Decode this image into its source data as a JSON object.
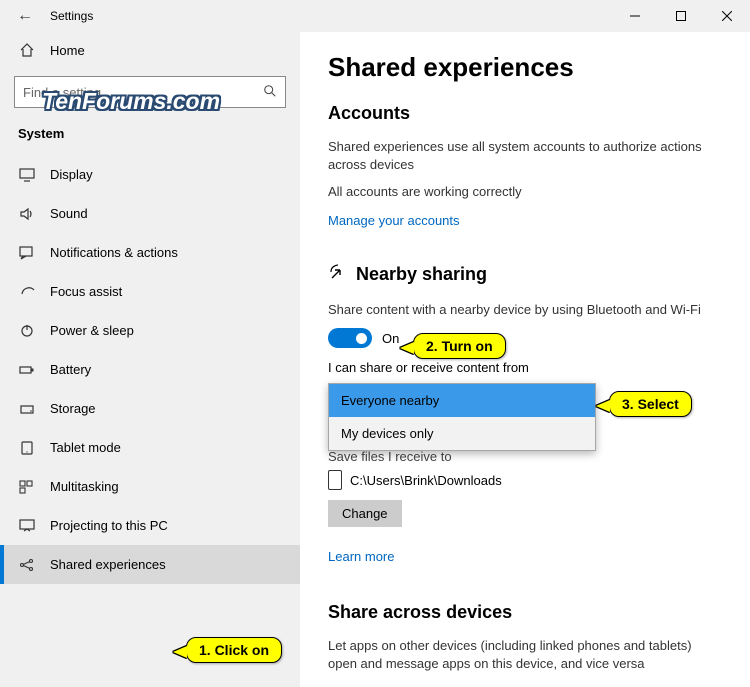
{
  "titlebar": {
    "title": "Settings"
  },
  "watermark": "TenForums.com",
  "sidebar": {
    "home": "Home",
    "search_placeholder": "Find a setting",
    "category": "System",
    "items": [
      {
        "label": "Display"
      },
      {
        "label": "Sound"
      },
      {
        "label": "Notifications & actions"
      },
      {
        "label": "Focus assist"
      },
      {
        "label": "Power & sleep"
      },
      {
        "label": "Battery"
      },
      {
        "label": "Storage"
      },
      {
        "label": "Tablet mode"
      },
      {
        "label": "Multitasking"
      },
      {
        "label": "Projecting to this PC"
      },
      {
        "label": "Shared experiences"
      }
    ]
  },
  "content": {
    "page_title": "Shared experiences",
    "accounts": {
      "heading": "Accounts",
      "desc": "Shared experiences use all system accounts to authorize actions across devices",
      "status": "All accounts are working correctly",
      "manage_link": "Manage your accounts"
    },
    "nearby": {
      "heading": "Nearby sharing",
      "desc": "Share content with a nearby device by using Bluetooth and Wi-Fi",
      "toggle_label": "On",
      "share_label": "I can share or receive content from",
      "options": [
        "Everyone nearby",
        "My devices only"
      ],
      "save_label": "Save files I receive to",
      "path": "C:\\Users\\Brink\\Downloads",
      "change": "Change",
      "learn_more": "Learn more"
    },
    "share_across": {
      "heading": "Share across devices",
      "desc": "Let apps on other devices (including linked phones and tablets) open and message apps on this device, and vice versa"
    }
  },
  "callouts": {
    "c1": "1. Click on",
    "c2": "2. Turn on",
    "c3": "3. Select"
  }
}
